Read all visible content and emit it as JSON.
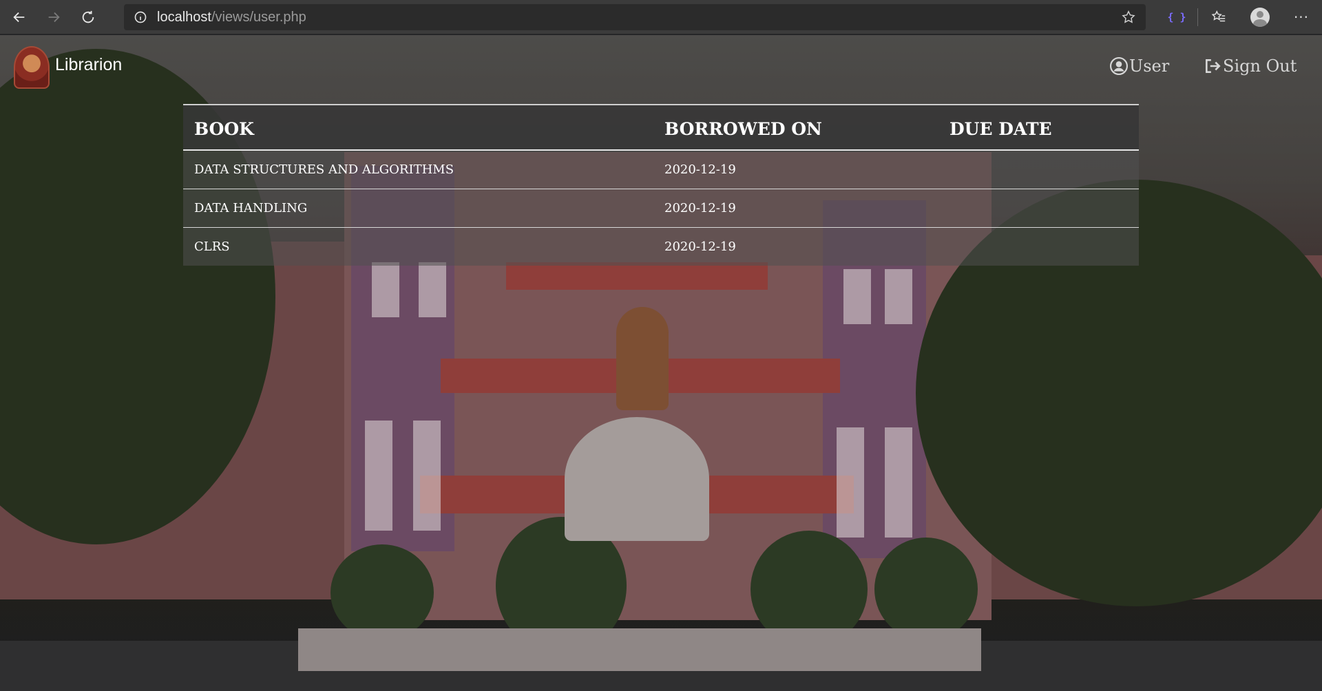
{
  "browser": {
    "url_host": "localhost",
    "url_path": "/views/user.php",
    "icons": [
      "back-arrow-icon",
      "forward-arrow-icon",
      "refresh-icon",
      "info-icon",
      "star-icon",
      "extension-icon",
      "favorites-icon",
      "profile-icon",
      "more-icon"
    ],
    "extension_label": "{ }",
    "more_label": "···"
  },
  "navbar": {
    "brand": "Librarion",
    "user_label": "User",
    "signout_label": "Sign Out"
  },
  "table": {
    "headers": [
      "BOOK",
      "BORROWED ON",
      "DUE DATE"
    ],
    "rows": [
      {
        "book": "DATA STRUCTURES AND ALGORITHMS",
        "borrowed_on": "2020-12-19",
        "due_date": ""
      },
      {
        "book": "DATA HANDLING",
        "borrowed_on": "2020-12-19",
        "due_date": ""
      },
      {
        "book": "CLRS",
        "borrowed_on": "2020-12-19",
        "due_date": ""
      }
    ]
  }
}
